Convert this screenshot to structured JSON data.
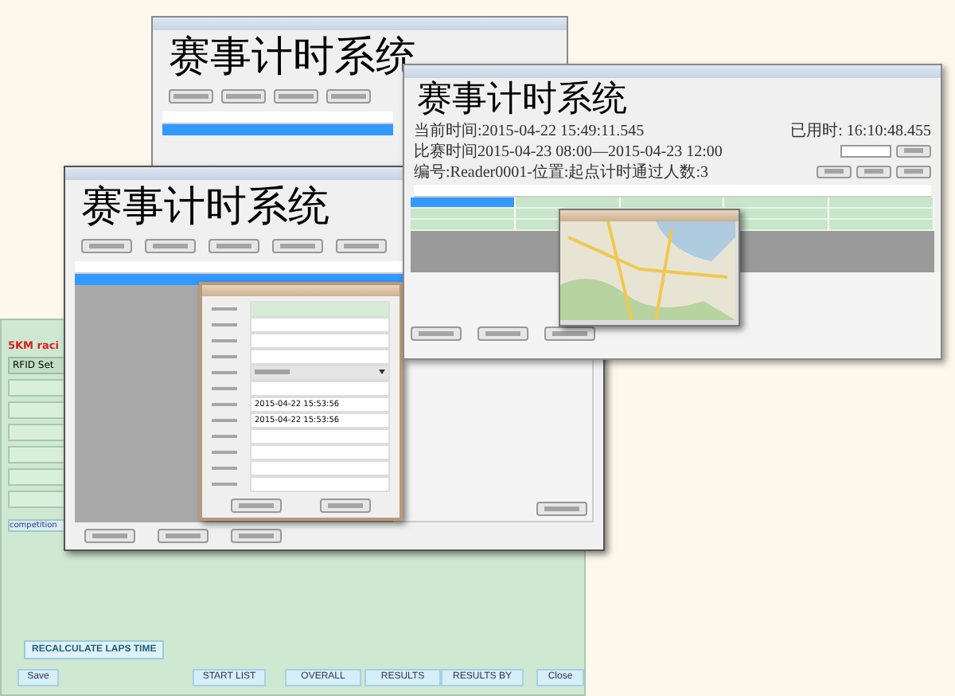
{
  "back_window": {
    "title": "赛事计时系统",
    "rows": [
      {
        "selected": true
      }
    ]
  },
  "green_window": {
    "heading": "5KM raci",
    "tab": "RFID Set",
    "section": "competition",
    "recalc_button": "RECALCULATE LAPS TIME",
    "buttons": [
      "Save",
      "START LIST",
      "OVERALL",
      "RESULTS",
      "RESULTS BY",
      "Close"
    ]
  },
  "main_window": {
    "title": "赛事计时系统",
    "rows": [
      {
        "selected": true
      }
    ],
    "dialog": {
      "fields": [
        {
          "kind": "readonly"
        },
        {
          "kind": "text"
        },
        {
          "kind": "text"
        },
        {
          "kind": "text"
        },
        {
          "kind": "dropdown"
        },
        {
          "kind": "text"
        },
        {
          "kind": "date",
          "value": "2015-04-22 15:53:56"
        },
        {
          "kind": "date",
          "value": "2015-04-22 15:53:56"
        },
        {
          "kind": "text"
        },
        {
          "kind": "text"
        },
        {
          "kind": "text"
        },
        {
          "kind": "text"
        }
      ]
    }
  },
  "monitor_window": {
    "title": "赛事计时系统",
    "current_time": "当前时间:2015-04-22 15:49:11.545",
    "elapsed": "已用时: 16:10:48.455",
    "race_time": "比赛时间2015-04-23 08:00—2015-04-23 12:00",
    "reader_info": "编号:Reader0001-位置:起点计时通过人数:3",
    "rows": [
      {
        "selected": true
      },
      {
        "selected": false
      },
      {
        "selected": false
      }
    ]
  }
}
